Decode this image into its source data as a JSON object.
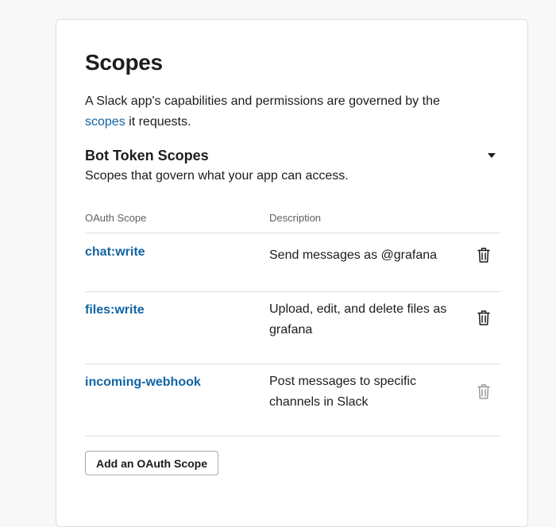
{
  "section": {
    "title": "Scopes",
    "intro_before": "A Slack app's capabilities and permissions are governed by the ",
    "intro_link": "scopes",
    "intro_after": " it requests."
  },
  "bot_scopes": {
    "title": "Bot Token Scopes",
    "subtitle": "Scopes that govern what your app can access.",
    "columns": {
      "scope": "OAuth Scope",
      "description": "Description"
    },
    "rows": [
      {
        "scope": "chat:write",
        "description": "Send messages as @grafana",
        "removable": true
      },
      {
        "scope": "files:write",
        "description": "Upload, edit, and delete files as grafana",
        "removable": true
      },
      {
        "scope": "incoming-webhook",
        "description": "Post messages to specific channels in Slack",
        "removable": false
      }
    ],
    "add_button": "Add an OAuth Scope"
  },
  "icons": {
    "collapse": "caret-down-icon",
    "remove": "trash-icon"
  },
  "colors": {
    "link": "#1264a3",
    "text": "#1d1c1d",
    "muted": "#616061",
    "border": "#dddddd"
  }
}
